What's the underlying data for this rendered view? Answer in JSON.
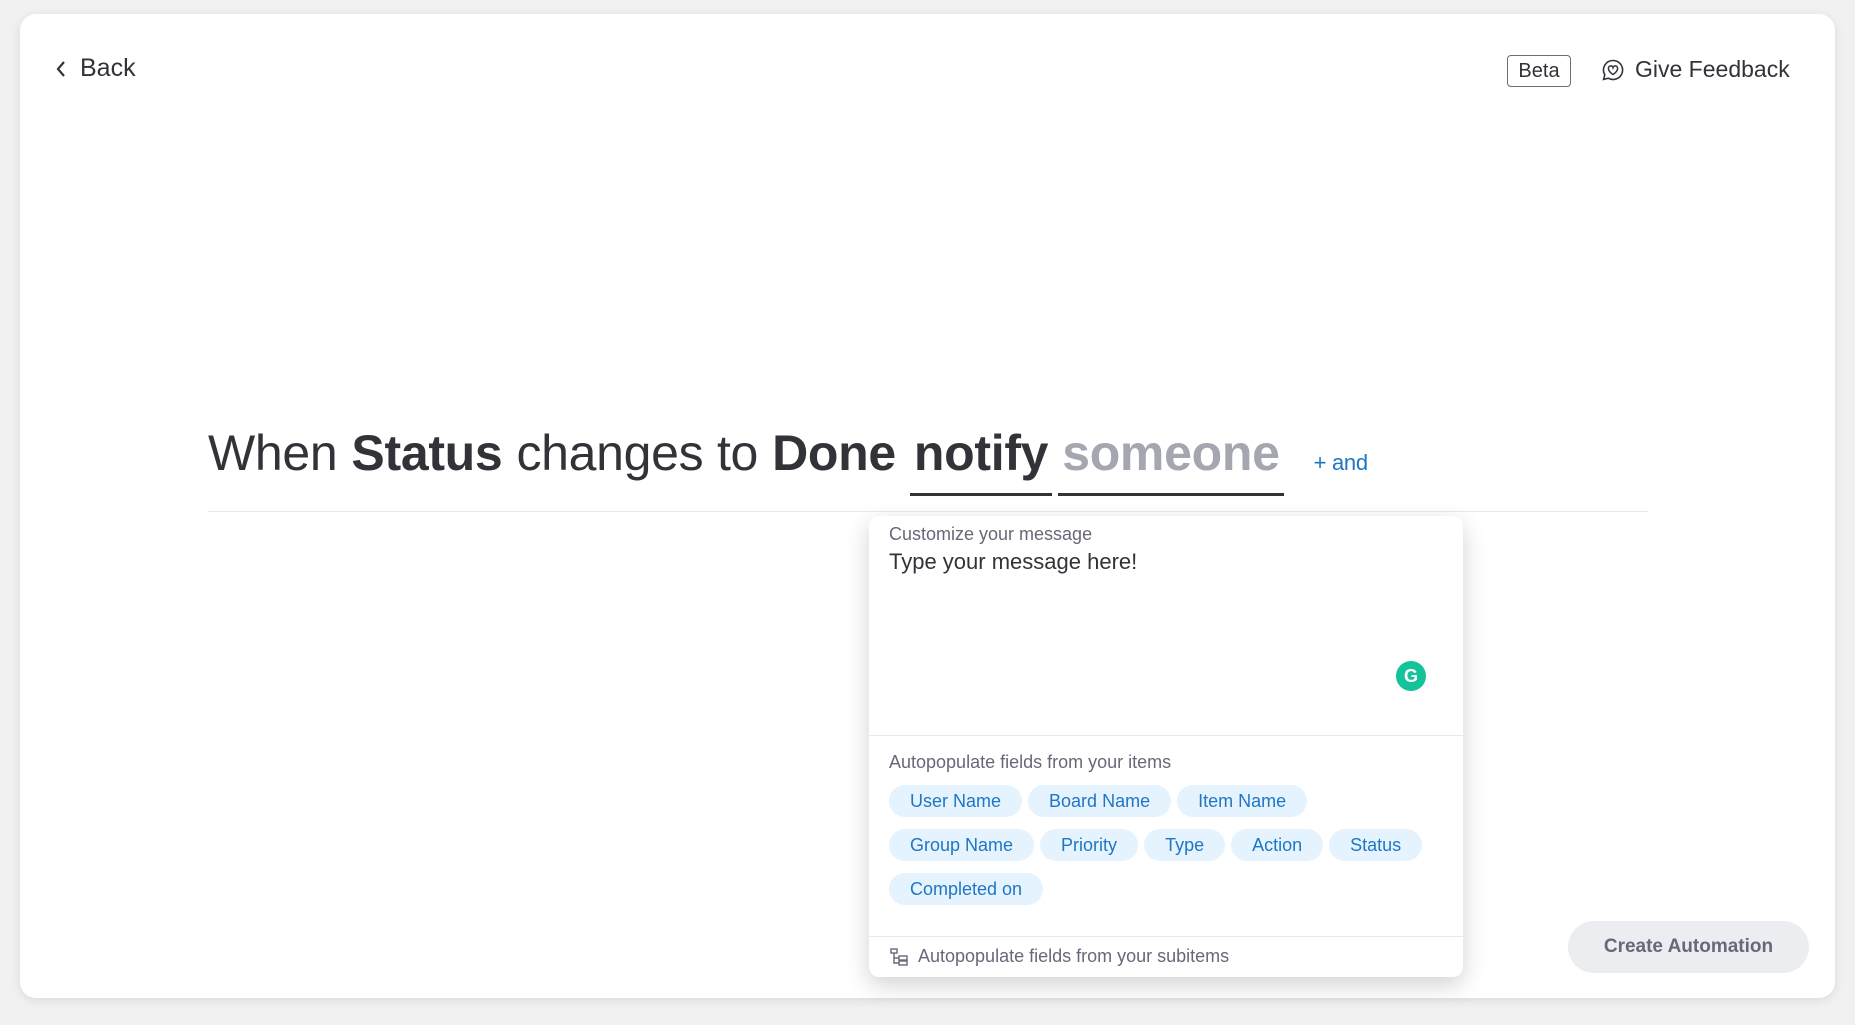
{
  "header": {
    "back_label": "Back",
    "beta_label": "Beta",
    "feedback_label": "Give Feedback"
  },
  "sentence": {
    "when": "When",
    "status": "Status",
    "changes_to": "changes to",
    "done": "Done",
    "notify": "notify",
    "someone": "someone",
    "plus_and": "+ and"
  },
  "popup": {
    "customize_label": "Customize your message",
    "message_value": "Type your message here!",
    "autopopulate_label": "Autopopulate fields from your items",
    "chips": [
      "User Name",
      "Board Name",
      "Item Name",
      "Group Name",
      "Priority",
      "Type",
      "Action",
      "Status",
      "Completed on"
    ],
    "subitems_label": "Autopopulate fields from your subitems"
  },
  "footer": {
    "create_label": "Create Automation"
  },
  "colors": {
    "accent": "#1f76c2",
    "chip_bg": "#e5f3ff",
    "grammarly": "#15c39a"
  }
}
